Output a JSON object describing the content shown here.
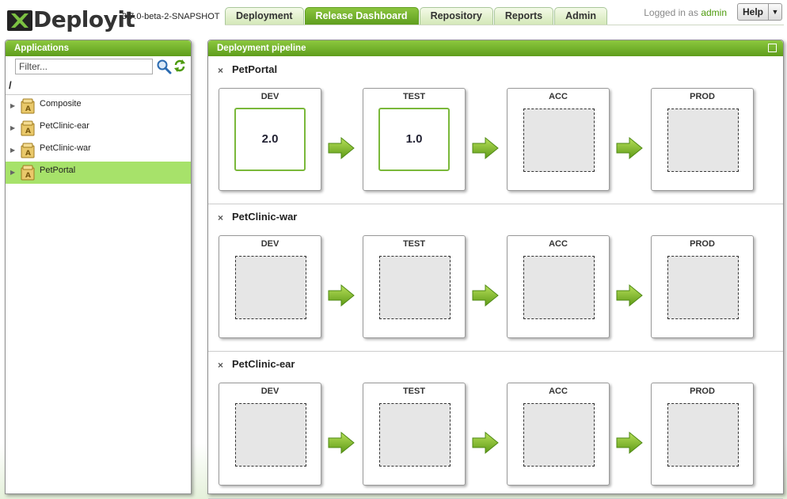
{
  "header": {
    "app_name": "Deployit",
    "version": "3.7.0-beta-2-SNAPSHOT",
    "tabs": [
      {
        "label": "Deployment"
      },
      {
        "label": "Release Dashboard"
      },
      {
        "label": "Repository"
      },
      {
        "label": "Reports"
      },
      {
        "label": "Admin"
      }
    ],
    "active_tab": "Release Dashboard",
    "logged_in_prefix": "Logged in as",
    "user": "admin",
    "help_label": "Help"
  },
  "applications_panel": {
    "title": "Applications",
    "filter_placeholder": "Filter...",
    "root": "/",
    "items": [
      {
        "label": "Composite"
      },
      {
        "label": "PetClinic-ear"
      },
      {
        "label": "PetClinic-war"
      },
      {
        "label": "PetPortal"
      }
    ],
    "selected": "PetPortal"
  },
  "pipeline_panel": {
    "title": "Deployment pipeline",
    "sections": [
      {
        "name": "PetPortal",
        "stages": [
          {
            "name": "DEV",
            "version": "2.0"
          },
          {
            "name": "TEST",
            "version": "1.0"
          },
          {
            "name": "ACC",
            "version": ""
          },
          {
            "name": "PROD",
            "version": ""
          }
        ]
      },
      {
        "name": "PetClinic-war",
        "stages": [
          {
            "name": "DEV",
            "version": ""
          },
          {
            "name": "TEST",
            "version": ""
          },
          {
            "name": "ACC",
            "version": ""
          },
          {
            "name": "PROD",
            "version": ""
          }
        ]
      },
      {
        "name": "PetClinic-ear",
        "stages": [
          {
            "name": "DEV",
            "version": ""
          },
          {
            "name": "TEST",
            "version": ""
          },
          {
            "name": "ACC",
            "version": ""
          },
          {
            "name": "PROD",
            "version": ""
          }
        ]
      }
    ]
  },
  "colors": {
    "brand_green": "#6fb02a",
    "selection": "#a7e26a"
  }
}
